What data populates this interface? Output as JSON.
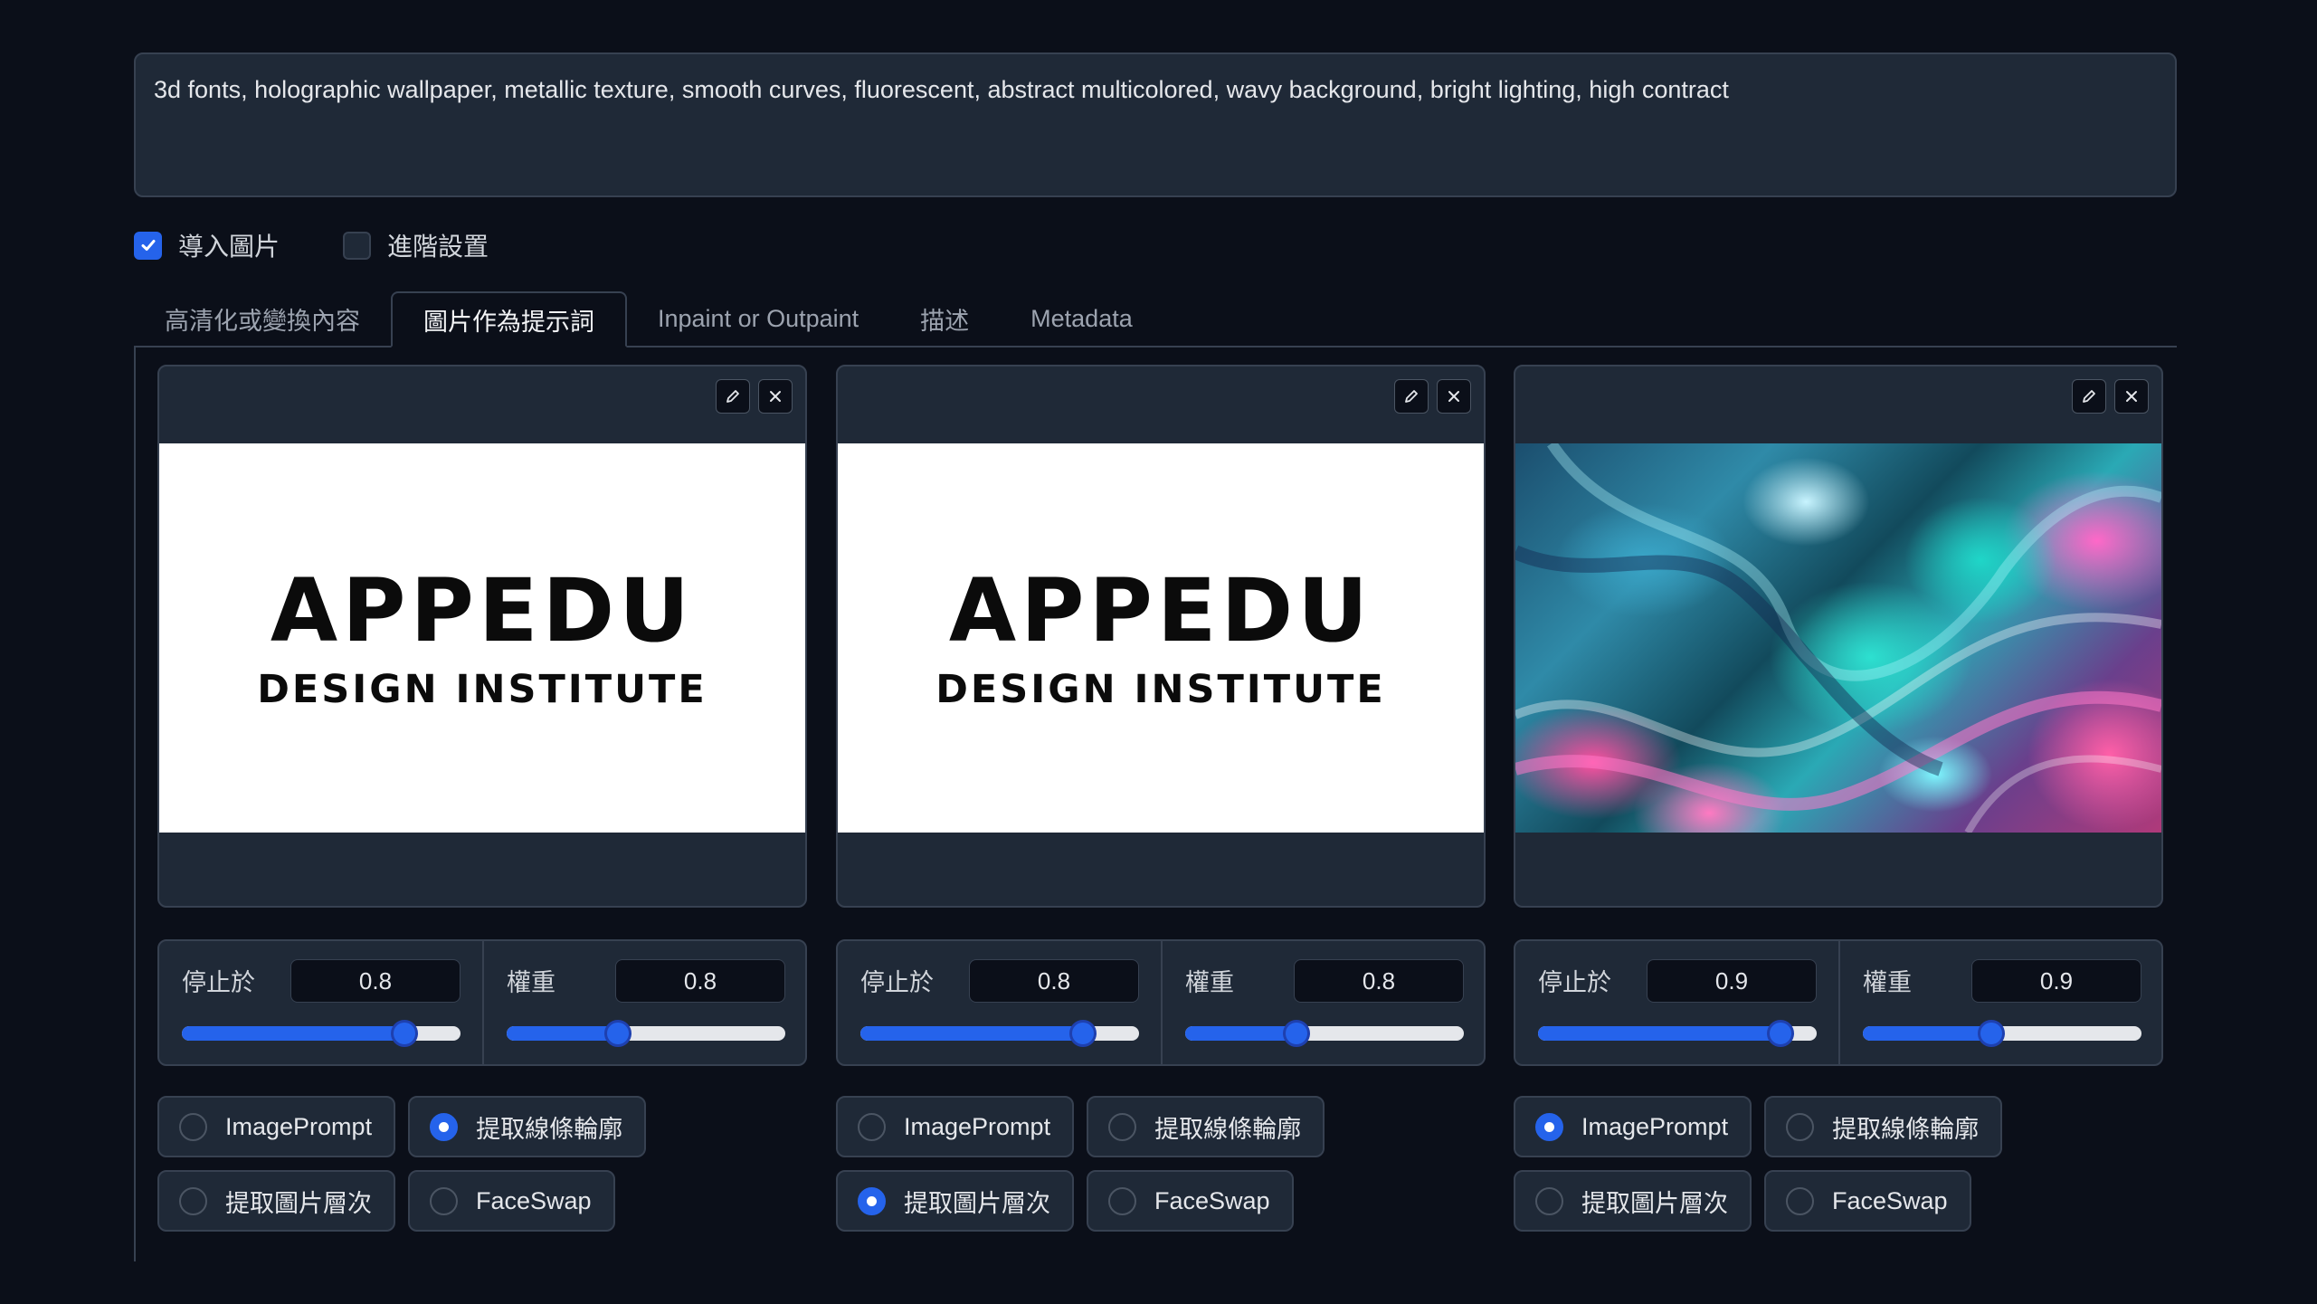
{
  "prompt": {
    "text": "3d fonts, holographic wallpaper, metallic texture, smooth curves, fluorescent, abstract multicolored, wavy background, bright lighting, high contract"
  },
  "options": [
    {
      "label": "導入圖片",
      "checked": true
    },
    {
      "label": "進階設置",
      "checked": false
    }
  ],
  "tabs": [
    {
      "label": "高清化或變換內容",
      "active": false
    },
    {
      "label": "圖片作為提示詞",
      "active": true
    },
    {
      "label": "Inpaint or Outpaint",
      "active": false
    },
    {
      "label": "描述",
      "active": false
    },
    {
      "label": "Metadata",
      "active": false
    }
  ],
  "colors": {
    "accent": "#2563eb",
    "background": "#0b0f19",
    "panel": "#1f2937",
    "border": "#374151"
  },
  "panels": [
    {
      "image": {
        "type": "logo",
        "logo_main": "APPEDU",
        "logo_sub": "DESIGN INSTITUTE"
      },
      "stop_at": {
        "label": "停止於",
        "value": "0.8",
        "level": 0.8
      },
      "weight": {
        "label": "權重",
        "value": "0.8",
        "level": 0.4
      },
      "radios": [
        {
          "label": "ImagePrompt",
          "selected": false
        },
        {
          "label": "提取線條輪廓",
          "selected": true
        },
        {
          "label": "提取圖片層次",
          "selected": false
        },
        {
          "label": "FaceSwap",
          "selected": false
        }
      ]
    },
    {
      "image": {
        "type": "logo",
        "logo_main": "APPEDU",
        "logo_sub": "DESIGN INSTITUTE"
      },
      "stop_at": {
        "label": "停止於",
        "value": "0.8",
        "level": 0.8
      },
      "weight": {
        "label": "權重",
        "value": "0.8",
        "level": 0.4
      },
      "radios": [
        {
          "label": "ImagePrompt",
          "selected": false
        },
        {
          "label": "提取線條輪廓",
          "selected": false
        },
        {
          "label": "提取圖片層次",
          "selected": true
        },
        {
          "label": "FaceSwap",
          "selected": false
        }
      ]
    },
    {
      "image": {
        "type": "holographic"
      },
      "stop_at": {
        "label": "停止於",
        "value": "0.9",
        "level": 0.9
      },
      "weight": {
        "label": "權重",
        "value": "0.9",
        "level": 0.45
      },
      "radios": [
        {
          "label": "ImagePrompt",
          "selected": true
        },
        {
          "label": "提取線條輪廓",
          "selected": false
        },
        {
          "label": "提取圖片層次",
          "selected": false
        },
        {
          "label": "FaceSwap",
          "selected": false
        }
      ]
    }
  ]
}
